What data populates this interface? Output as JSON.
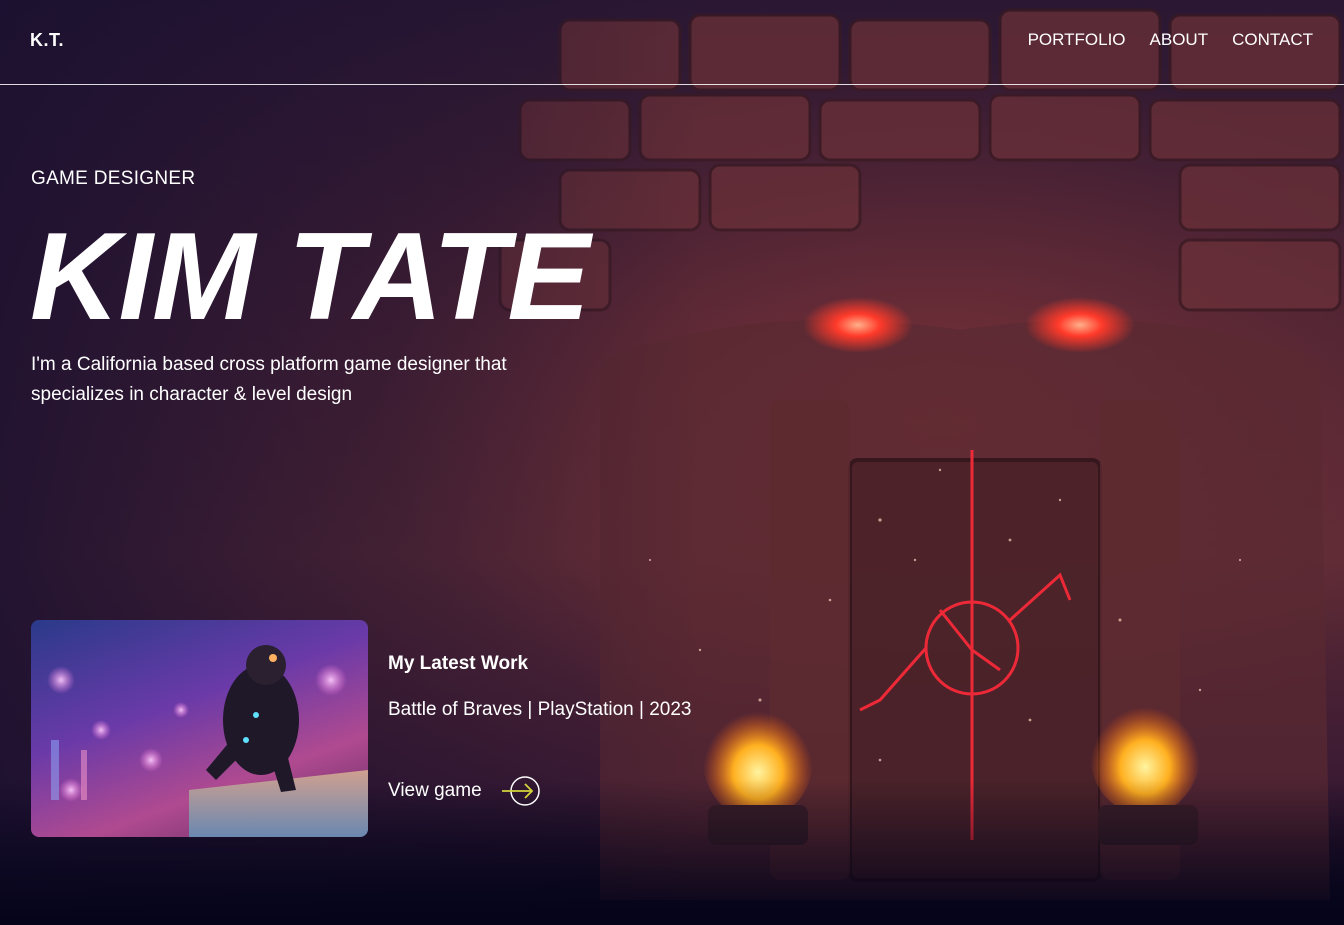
{
  "header": {
    "logo": "K.T.",
    "nav": [
      {
        "label": "PORTFOLIO"
      },
      {
        "label": "ABOUT"
      },
      {
        "label": "CONTACT"
      }
    ]
  },
  "hero": {
    "eyebrow": "GAME DESIGNER",
    "title": "KIM TATE",
    "description": "I'm a California based cross platform game designer that specializes in character & level design"
  },
  "latest_work": {
    "heading": "My Latest Work",
    "meta": "Battle of Braves | PlayStation | 2023",
    "link_label": "View game",
    "link_icon": "arrow-right-circle-icon",
    "accent_color": "#d4d43a"
  },
  "theme": {
    "text_color": "#ffffff",
    "glow_color": "#ff3a2a",
    "background_dark": "#05041a"
  }
}
